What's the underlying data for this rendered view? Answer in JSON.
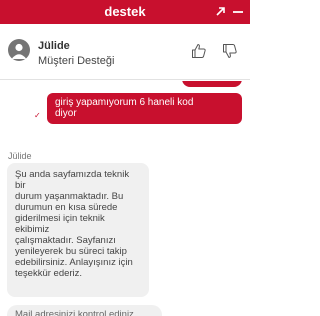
{
  "topbar": {
    "title": "destek",
    "background": "#c8102e",
    "expand_icon": "expand-arrow-icon",
    "minimize_icon": "minimize-icon"
  },
  "agent": {
    "name": "Jülide",
    "role": "Müşteri Desteği",
    "avatar_icon": "user-avatar-icon",
    "feedback": {
      "like_icon": "thumbs-up-icon",
      "dislike_icon": "thumbs-down-icon"
    }
  },
  "messages": {
    "user_message": {
      "lines": [
        "giriş yapamıyorum 6 haneli kod",
        "diyor"
      ],
      "status_icon": "check-icon",
      "background": "#c8102e"
    },
    "agent_sender": "Jülide",
    "agent_message": {
      "lines": [
        "Şu anda sayfamızda teknik bir",
        "durum yaşanmaktadır. Bu",
        "durumun en kısa sürede",
        "giderilmesi için teknik ekibimiz",
        "çalışmaktadır. Sayfanızı",
        "yenileyerek bu süreci takip",
        "edebilirsiniz. Anlayışınız için",
        "teşekkür ederiz."
      ]
    }
  },
  "suggestion": {
    "label": "Mail adresinizi kontrol ediniz"
  }
}
